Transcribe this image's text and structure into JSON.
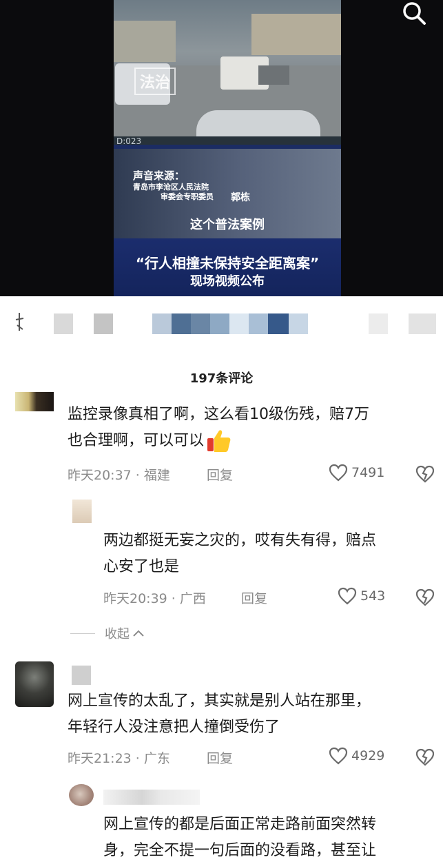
{
  "video": {
    "logo_text": "法治",
    "timestamp": "D:023",
    "source_title": "声音来源：",
    "source_org": "青岛市李沧区人民法院",
    "source_role": "审委会专职委员",
    "speaker_name": "郭栋",
    "subtitle": "这个普法案例",
    "headline_line1": "“行人相撞未保持安全距离案”",
    "headline_line2": "现场视频公布"
  },
  "comments_header": {
    "count_label": "197条评论"
  },
  "comments": [
    {
      "text_line1": "监控录像真相了啊，这么看10级伤残，赔7万",
      "text_line2": "也合理啊，可以可以",
      "time": "昨天20:37",
      "location": "福建",
      "reply_label": "回复",
      "likes": "7491"
    },
    {
      "text_line1": "两边都挺无妄之灾的，哎有失有得，赔点",
      "text_line2": "心安了也是",
      "time": "昨天20:39",
      "location": "广西",
      "reply_label": "回复",
      "likes": "543"
    },
    {
      "text_line1": "网上宣传的太乱了，其实就是别人站在那里，",
      "text_line2": "年轻行人没注意把人撞倒受伤了",
      "time": "昨天21:23",
      "location": "广东",
      "reply_label": "回复",
      "likes": "4929"
    },
    {
      "text_line1": "网上宣传的都是后面正常走路前面突然转",
      "text_line2": "身，完全不提一句后面的没看路，甚至让"
    }
  ],
  "collapse_label": "收起",
  "icons": {
    "search": "search-icon",
    "like": "heart-outline-icon",
    "dislike": "broken-heart-icon",
    "thumbs_up": "thumbs-up-emoji-icon",
    "chevron": "chevron-up-icon"
  },
  "colors": {
    "video_bg": "#0b0b0d",
    "headline_bg": "#1b2d6d",
    "text": "#1c1c1c",
    "meta": "#8b8b8b"
  }
}
